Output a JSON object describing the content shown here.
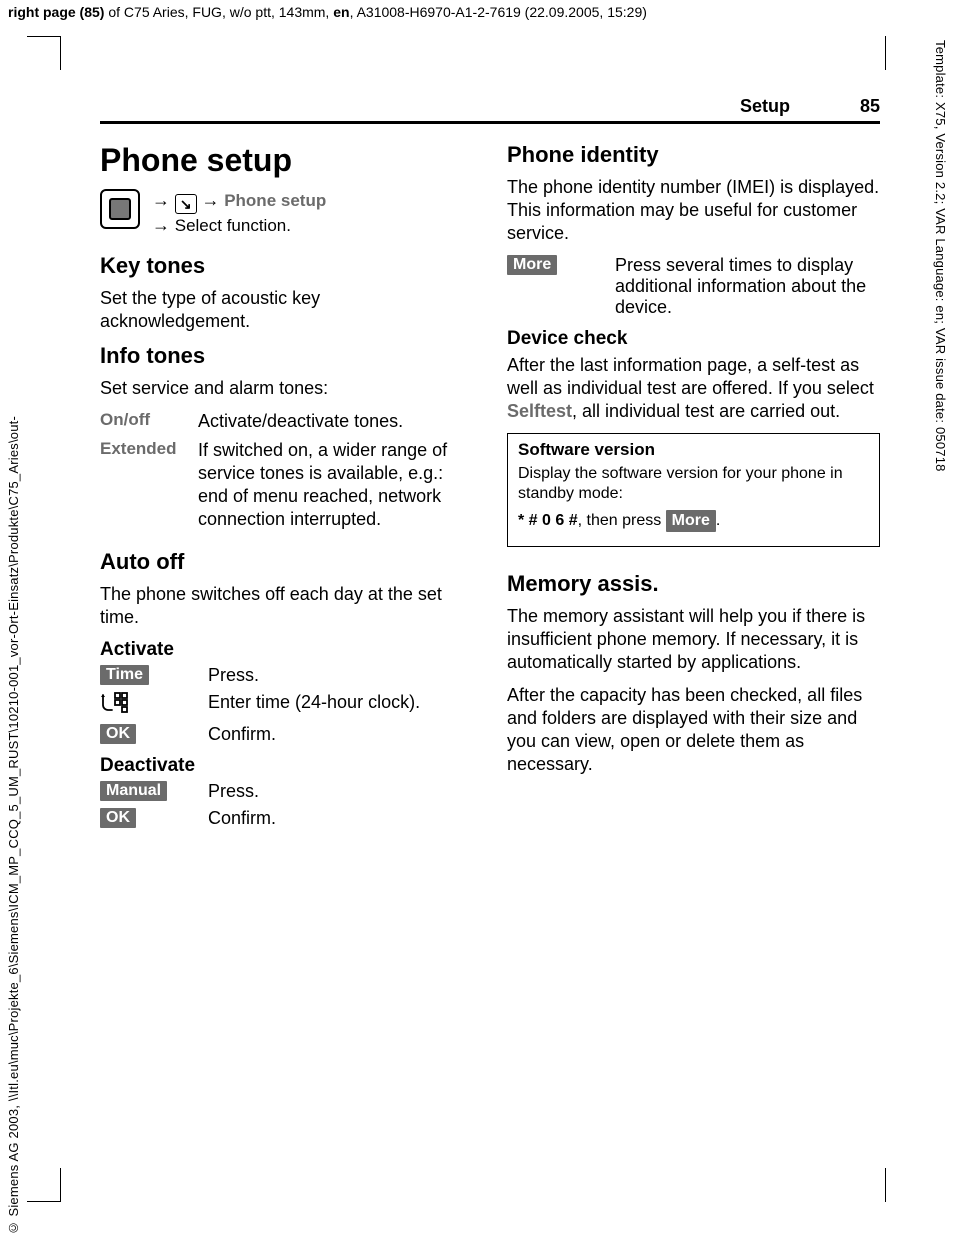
{
  "meta": {
    "top_header_bold1": "right page (85)",
    "top_header_rest": " of C75 Aries, FUG,  w/o ptt, 143mm, ",
    "top_header_lang": "en",
    "top_header_tail": ", A31008-H6970-A1-2-7619 (22.09.2005, 15:29)",
    "right_vertical": "Template: X75, Version 2.2; VAR Language: en; VAR issue date: 050718",
    "left_vertical": "© Siemens AG 2003, \\\\Itl.eu\\muc\\Projekte_6\\Siemens\\ICM_MP_CCQ_5_UM_RUST\\10210-001_vor-Ort-Einsatz\\Produkte\\C75_Aries\\out-"
  },
  "running_head": {
    "section": "Setup",
    "page": "85"
  },
  "left": {
    "h1": "Phone setup",
    "breadcrumb_target": "Phone setup",
    "breadcrumb_select": "Select function.",
    "key_tones_h": "Key tones",
    "key_tones_p": "Set the type of acoustic key acknowledgement.",
    "info_tones_h": "Info tones",
    "info_tones_p": "Set service and alarm tones:",
    "onoff_label": "On/off",
    "onoff_text": "Activate/deactivate tones.",
    "extended_label": "Extended",
    "extended_text": "If switched on, a wider range of service tones is available, e.g.: end of menu reached, network connection interrupted.",
    "auto_off_h": "Auto off",
    "auto_off_p": "The phone switches off each day at the set time.",
    "activate_h": "Activate",
    "time_btn": "Time",
    "time_text": "Press.",
    "enter_time_text": "Enter time (24-hour clock).",
    "ok_btn": "OK",
    "ok_text": "Confirm.",
    "deactivate_h": "Deactivate",
    "manual_btn": "Manual",
    "manual_text": "Press.",
    "ok2_text": "Confirm."
  },
  "right": {
    "identity_h": "Phone identity",
    "identity_p": "The phone identity number (IMEI) is displayed. This information may be useful for customer service.",
    "more_btn": "More",
    "more_text": "Press several times to display additional information about the device.",
    "device_check_h": "Device check",
    "device_check_p1": "After the last information page, a self-test as well as individual test are offered. If you select ",
    "selftest_label": "Selftest",
    "device_check_p2": ", all individual test are carried out.",
    "box_h": "Software version",
    "box_p": "Display the software version for your phone in standby mode:",
    "box_code": "* # 0 6 #",
    "box_then": ", then press ",
    "memory_h": "Memory assis.",
    "memory_p1": "The memory assistant will help you if there is insufficient phone memory. If necessary, it is automatically started by applications.",
    "memory_p2": "After the capacity has been checked, all files and folders are displayed with their size and you can view, open or delete them as necessary."
  }
}
